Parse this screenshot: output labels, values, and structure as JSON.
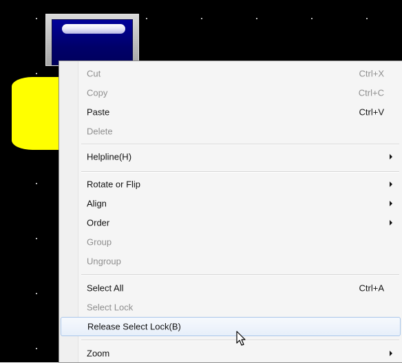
{
  "context_menu": {
    "items": [
      {
        "label": "Cut",
        "shortcut": "Ctrl+X",
        "disabled": true
      },
      {
        "label": "Copy",
        "shortcut": "Ctrl+C",
        "disabled": true
      },
      {
        "label": "Paste",
        "shortcut": "Ctrl+V",
        "disabled": false
      },
      {
        "label": "Delete",
        "shortcut": "",
        "disabled": true
      },
      {
        "label": "Helpline(H)",
        "shortcut": "",
        "disabled": false,
        "submenu": true
      },
      {
        "label": "Rotate or Flip",
        "shortcut": "",
        "disabled": false,
        "submenu": true
      },
      {
        "label": "Align",
        "shortcut": "",
        "disabled": false,
        "submenu": true
      },
      {
        "label": "Order",
        "shortcut": "",
        "disabled": false,
        "submenu": true
      },
      {
        "label": "Group",
        "shortcut": "",
        "disabled": true
      },
      {
        "label": "Ungroup",
        "shortcut": "",
        "disabled": true
      },
      {
        "label": "Select All",
        "shortcut": "Ctrl+A",
        "disabled": false
      },
      {
        "label": "Select Lock",
        "shortcut": "",
        "disabled": true
      },
      {
        "label": "Release Select Lock(B)",
        "shortcut": "",
        "disabled": false,
        "highlighted": true
      },
      {
        "label": "Zoom",
        "shortcut": "",
        "disabled": false,
        "submenu": true
      }
    ]
  },
  "colors": {
    "canvas_background": "#000000",
    "panel_blue": "#00009a",
    "shape_yellow": "#ffff00",
    "menu_background": "#f5f5f5",
    "highlight_border": "#a9c6ea",
    "disabled_text": "#8e8e8e"
  },
  "icons": {
    "submenu_arrow": "triangle-right-icon",
    "cursor": "mouse-pointer-icon"
  }
}
